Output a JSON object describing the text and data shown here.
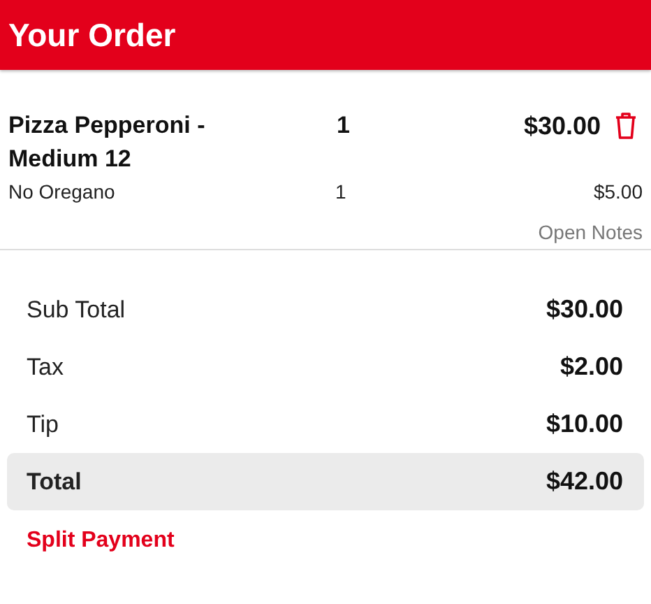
{
  "header": {
    "title": "Your Order"
  },
  "items": [
    {
      "name": "Pizza Pepperoni - Medium 12",
      "quantity": "1",
      "price": "$30.00",
      "modifiers": [
        {
          "name": "No Oregano",
          "quantity": "1",
          "price": "$5.00"
        }
      ]
    }
  ],
  "notes_link": "Open Notes",
  "summary": [
    {
      "kind": "line",
      "label": "Sub Total",
      "value": "$30.00"
    },
    {
      "kind": "line",
      "label": "Tax",
      "value": "$2.00"
    },
    {
      "kind": "line",
      "label": "Tip",
      "value": "$10.00"
    },
    {
      "kind": "total",
      "label": "Total",
      "value": "$42.00"
    }
  ],
  "split_link": "Split Payment"
}
